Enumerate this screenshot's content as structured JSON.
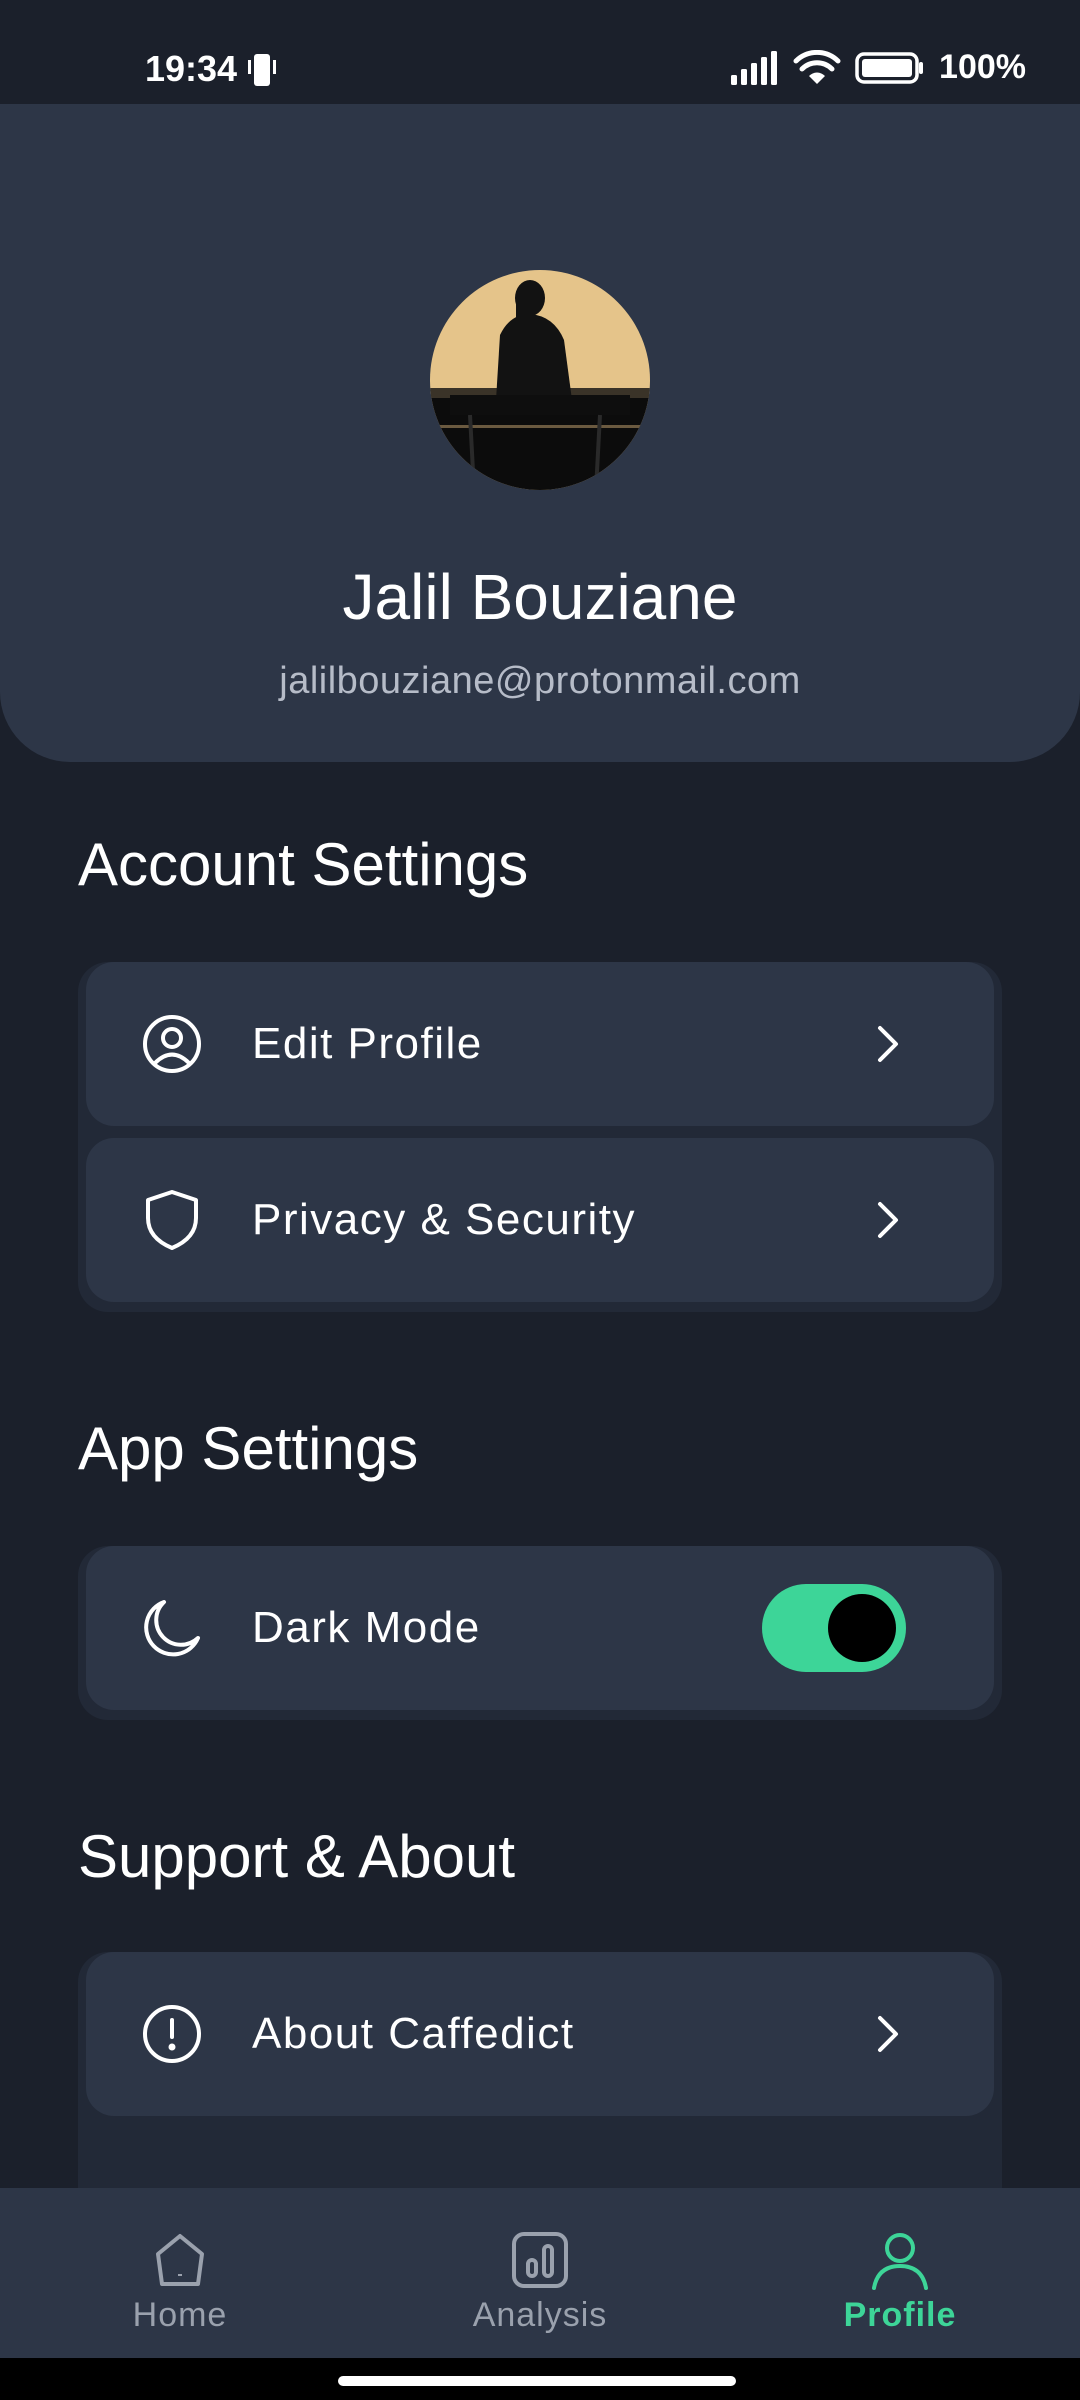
{
  "status_bar": {
    "time": "19:34",
    "battery": "100%",
    "icons": [
      "phone-vibrate-icon",
      "signal-icon",
      "wifi-icon",
      "battery-icon"
    ]
  },
  "profile": {
    "name": "Jalil Bouziane",
    "email": "jalilbouziane@protonmail.com",
    "avatar_icon": "avatar"
  },
  "sections": {
    "account_title": "Account Settings",
    "app_title": "App Settings",
    "support_title": "Support & About"
  },
  "account_items": [
    {
      "label": "Edit Profile",
      "icon": "user-circle-icon"
    },
    {
      "label": "Privacy & Security",
      "icon": "shield-icon"
    }
  ],
  "app_items": [
    {
      "label": "Dark Mode",
      "icon": "moon-icon",
      "toggle_on": true
    }
  ],
  "support_items": [
    {
      "label": "About Caffedict",
      "icon": "info-alert-icon"
    }
  ],
  "nav": {
    "items": [
      {
        "label": "Home",
        "icon": "home-icon",
        "active": false
      },
      {
        "label": "Analysis",
        "icon": "analysis-icon",
        "active": false
      },
      {
        "label": "Profile",
        "icon": "user-icon",
        "active": true
      }
    ]
  },
  "colors": {
    "background": "#1b202b",
    "card": "#2d3647",
    "accent": "#3dd598",
    "muted_text": "#9aa1ad"
  }
}
